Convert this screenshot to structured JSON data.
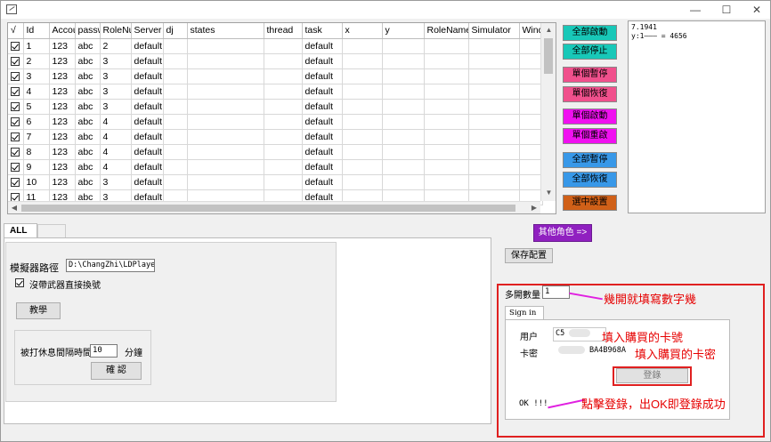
{
  "window": {
    "minimize": "—",
    "maximize": "☐",
    "close": "✕"
  },
  "grid": {
    "columns": [
      "√",
      "Id",
      "Accou",
      "passw",
      "RoleNu",
      "Server",
      "dj",
      "states",
      "thread",
      "task",
      "x",
      "y",
      "RoleName",
      "Simulator",
      "Wind"
    ],
    "rows": [
      {
        "checked": true,
        "id": "1",
        "account": "123",
        "password": "abc",
        "role_num": "2",
        "server": "default",
        "task": "default"
      },
      {
        "checked": true,
        "id": "2",
        "account": "123",
        "password": "abc",
        "role_num": "3",
        "server": "default",
        "task": "default"
      },
      {
        "checked": true,
        "id": "3",
        "account": "123",
        "password": "abc",
        "role_num": "3",
        "server": "default",
        "task": "default"
      },
      {
        "checked": true,
        "id": "4",
        "account": "123",
        "password": "abc",
        "role_num": "3",
        "server": "default",
        "task": "default"
      },
      {
        "checked": true,
        "id": "5",
        "account": "123",
        "password": "abc",
        "role_num": "3",
        "server": "default",
        "task": "default"
      },
      {
        "checked": true,
        "id": "6",
        "account": "123",
        "password": "abc",
        "role_num": "4",
        "server": "default",
        "task": "default"
      },
      {
        "checked": true,
        "id": "7",
        "account": "123",
        "password": "abc",
        "role_num": "4",
        "server": "default",
        "task": "default"
      },
      {
        "checked": true,
        "id": "8",
        "account": "123",
        "password": "abc",
        "role_num": "4",
        "server": "default",
        "task": "default"
      },
      {
        "checked": true,
        "id": "9",
        "account": "123",
        "password": "abc",
        "role_num": "4",
        "server": "default",
        "task": "default"
      },
      {
        "checked": true,
        "id": "10",
        "account": "123",
        "password": "abc",
        "role_num": "3",
        "server": "default",
        "task": "default"
      },
      {
        "checked": true,
        "id": "11",
        "account": "123",
        "password": "abc",
        "role_num": "3",
        "server": "default",
        "task": "default"
      }
    ]
  },
  "buttons": {
    "start_all": {
      "label": "全部啟動",
      "color": "#18c8b8"
    },
    "stop_all": {
      "label": "全部停止",
      "color": "#18c8b8"
    },
    "pause_one": {
      "label": "單個暫停",
      "color": "#f0508c"
    },
    "resume_one": {
      "label": "單個恢復",
      "color": "#f0508c"
    },
    "start_one": {
      "label": "單個啟動",
      "color": "#f010f0"
    },
    "restart_one": {
      "label": "單個重啟",
      "color": "#f010f0"
    },
    "pause_all": {
      "label": "全部暫停",
      "color": "#3898e8"
    },
    "resume_all": {
      "label": "全部恢復",
      "color": "#3898e8"
    },
    "selected_settings": {
      "label": "選中設置",
      "color": "#d06018"
    },
    "other_roles": {
      "label": "其他角色 =>",
      "color": "#9020c0"
    },
    "save_config": "保存配置"
  },
  "log": {
    "line1": "7.1941",
    "line2": "y:1——— = 4656"
  },
  "tabs": {
    "all": "ALL"
  },
  "settings": {
    "emulator_path_label": "模擬器路徑",
    "emulator_path_value": "D:\\ChangZhi\\LDPlayer\\d",
    "no_weapon_label": "沒帶武器直接換號",
    "no_weapon_checked": true,
    "tutorial_button": "教學",
    "rest_interval_label": "被打休息間隔時間",
    "rest_interval_value": "10",
    "minutes_label": "分鐘",
    "confirm_button": "確 認"
  },
  "signin": {
    "multi_count_label": "多開數量",
    "multi_count_value": "1",
    "tab_label": "Sign in",
    "user_label": "用户",
    "user_value": "C5",
    "password_label": "卡密",
    "password_value": "BA4B968A",
    "login_button": "登錄",
    "status": "OK !!!"
  },
  "annotations": {
    "count_hint": "幾開就填寫數字幾",
    "card_no_hint": "填入購買的卡號",
    "card_pwd_hint": "填入購買的卡密",
    "login_hint": "點擊登錄，出OK即登錄成功"
  }
}
